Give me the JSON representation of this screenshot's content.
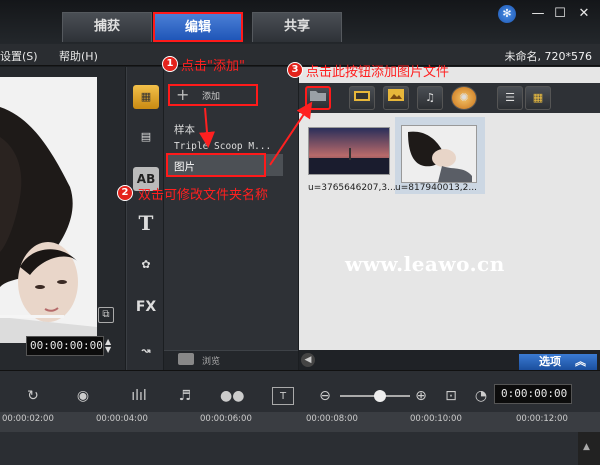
{
  "tabs": [
    {
      "label": "捕获",
      "active": false
    },
    {
      "label": "编辑",
      "active": true
    },
    {
      "label": "共享",
      "active": false
    }
  ],
  "window": {
    "help_icon": "snowflake-icon",
    "minimize": "—",
    "restore": "☐",
    "close": "✕"
  },
  "menu": {
    "settings": "设置(S)",
    "help": "帮助(H)"
  },
  "project_info": "未命名, 720*576",
  "preview": {
    "timecode": "00:00:00:00"
  },
  "library": {
    "add_label": "添加",
    "items": [
      "样本",
      "Triple Scoop M...",
      "图片"
    ],
    "selected": "图片",
    "browse_label": "浏览"
  },
  "media": {
    "thumbnails": [
      {
        "caption": "u=3765646207,3..."
      },
      {
        "caption": "u=817940013,2..."
      }
    ],
    "options_label": "选项"
  },
  "timeline": {
    "timecode": "0:00:00:00",
    "ticks": [
      "00:00:02:00",
      "00:00:04:00",
      "00:00:06:00",
      "00:00:08:00",
      "00:00:10:00",
      "00:00:12:00"
    ]
  },
  "annotations": {
    "step1": {
      "num": "1",
      "text": "点击\"添加\""
    },
    "step2": {
      "num": "2",
      "text": "双击可修改文件夹名称"
    },
    "step3": {
      "num": "3",
      "text": "点击此按钮添加图片文件"
    }
  },
  "watermark": "www.leawo.cn",
  "colors": {
    "annotation_red": "#ff1a1a",
    "active_tab_blue": "#1f56b8",
    "options_blue": "#3b7bd3"
  }
}
